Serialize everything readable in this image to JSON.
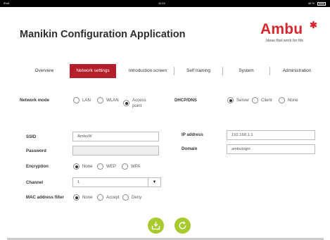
{
  "status_bar": {
    "left": "iPad",
    "time": "11:24",
    "right": "46 %"
  },
  "app": {
    "title": "Manikin Configuration Application"
  },
  "logo": {
    "text": "Ambu",
    "tagline": "Ideas that work for life",
    "color": "#d6262e"
  },
  "tabs": [
    {
      "label": "Overview",
      "active": false
    },
    {
      "label": "Network settings",
      "active": true
    },
    {
      "label": "Introduction screen",
      "active": false
    },
    {
      "label": "Self training",
      "active": false
    },
    {
      "label": "System",
      "active": false
    },
    {
      "label": "Administration",
      "active": false
    }
  ],
  "network_mode": {
    "label": "Network mode",
    "options": [
      {
        "label": "LAN",
        "selected": false
      },
      {
        "label": "WLAN",
        "selected": false
      },
      {
        "label": "Access",
        "label2": "point",
        "selected": true
      }
    ]
  },
  "dhcp": {
    "label": "DHCP/DNS",
    "options": [
      {
        "label": "Server",
        "selected": true
      },
      {
        "label": "Client",
        "selected": false
      },
      {
        "label": "None",
        "selected": false
      }
    ]
  },
  "ssid": {
    "label": "SSID",
    "value": "AmbuW"
  },
  "password": {
    "label": "Password",
    "value": ""
  },
  "encryption": {
    "label": "Encryption",
    "options": [
      {
        "label": "None",
        "selected": true
      },
      {
        "label": "WEP",
        "selected": false
      },
      {
        "label": "WPA",
        "selected": false
      }
    ]
  },
  "channel": {
    "label": "Channel",
    "value": "1"
  },
  "mac_filter": {
    "label": "MAC address filter",
    "options": [
      {
        "label": "None",
        "selected": true
      },
      {
        "label": "Accept",
        "selected": false
      },
      {
        "label": "Deny",
        "selected": false
      }
    ]
  },
  "ip_address": {
    "label": "IP address",
    "value": "192.168.1.1"
  },
  "domain": {
    "label": "Domain",
    "value": "ambulogin"
  },
  "colors": {
    "accent": "#b51f2a",
    "button": "#a9ca2e"
  },
  "actions": {
    "save_icon": "save-icon",
    "refresh_icon": "refresh-icon"
  }
}
